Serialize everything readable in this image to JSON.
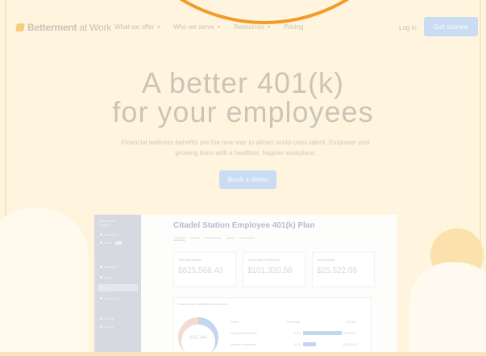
{
  "brand": {
    "name": "Betterment",
    "suffix": "at Work"
  },
  "nav": {
    "items": [
      {
        "label": "What we offer"
      },
      {
        "label": "Who we serve"
      },
      {
        "label": "Resources"
      },
      {
        "label": "Pricing"
      }
    ],
    "login": "Log in",
    "cta": "Get started"
  },
  "hero": {
    "title_line1": "A better 401(k)",
    "title_line2": "for your employees",
    "subtitle": "Financial wellness benefits are the new way to attract world-class talent. Empower your growing team with a healthier, happier workplace.",
    "button": "Book a demo"
  },
  "dashboard": {
    "sidebar": {
      "brand_line1": "Betterment",
      "brand_line2": "at Work",
      "items": [
        {
          "label": "Dashboard"
        },
        {
          "label": "Tasks"
        },
        {
          "label": "Employees"
        },
        {
          "label": "Payroll"
        },
        {
          "label": "Plan"
        },
        {
          "label": "Documents"
        },
        {
          "label": "Settings"
        },
        {
          "label": "Log out"
        }
      ]
    },
    "plan_title": "Citadel Station Employee 401(k) Plan",
    "tabs": [
      "Overview",
      "Activity",
      "Contributions",
      "Assets",
      "Documents"
    ],
    "cards": [
      {
        "label": "Total plan balance",
        "value": "$825,568.40"
      },
      {
        "label": "Year-to-date contributions",
        "value": "$101,320.58"
      },
      {
        "label": "Total earnings",
        "value": "$25,522.06"
      }
    ],
    "chart_title": "Year-to-date contributions by source",
    "donut_value": "$25,744",
    "table": {
      "headers": [
        "Source",
        "Percentage",
        "YTD total"
      ],
      "rows": [
        {
          "source": "Employee contributions",
          "pct": "74.9%",
          "value": "$75,968.20",
          "share": 0.749
        },
        {
          "source": "Employer contributions",
          "pct": "25.1%",
          "value": "$25,352.38",
          "share": 0.251
        }
      ]
    }
  },
  "colors": {
    "background": "#fff4de",
    "accent_orange": "#f39a2a",
    "button_blue": "#c9dcf2"
  }
}
